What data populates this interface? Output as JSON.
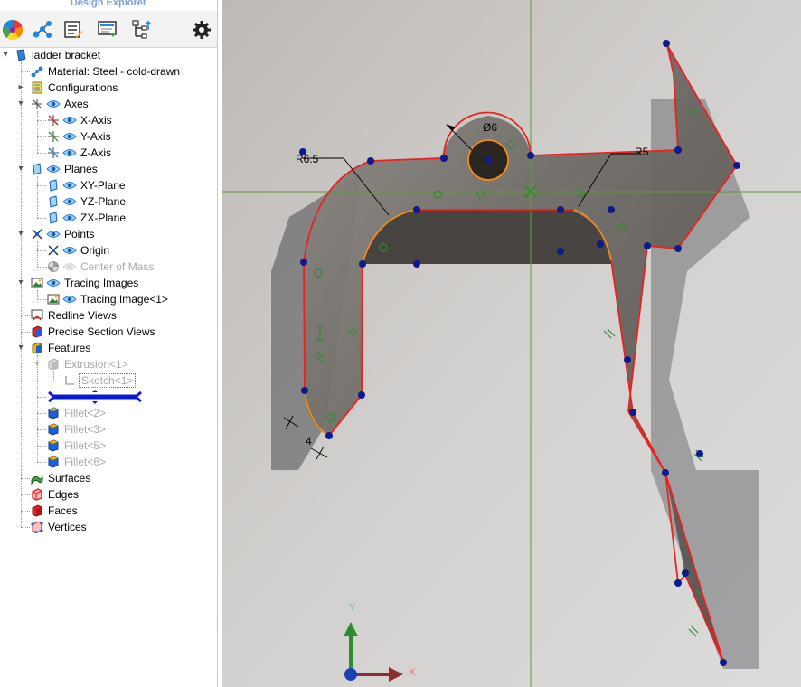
{
  "explorer": {
    "title": "Design Explorer",
    "toolbar": {
      "appearance": "color-wheel-icon",
      "relations": "relations-icon",
      "properties": "properties-icon",
      "view": "view-icon",
      "tree_mode": "tree-mode-icon",
      "settings": "gear-icon"
    },
    "tree": {
      "root": "ladder bracket",
      "material": "Material: Steel - cold-drawn",
      "configurations": "Configurations",
      "axes": "Axes",
      "x_axis": "X-Axis",
      "y_axis": "Y-Axis",
      "z_axis": "Z-Axis",
      "planes": "Planes",
      "xy_plane": "XY-Plane",
      "yz_plane": "YZ-Plane",
      "zx_plane": "ZX-Plane",
      "points": "Points",
      "origin": "Origin",
      "center_of_mass": "Center of Mass",
      "tracing_images": "Tracing Images",
      "tracing_image_1": "Tracing Image<1>",
      "redline_views": "Redline Views",
      "precise_section_views": "Precise Section Views",
      "features": "Features",
      "extrusion_1": "Extrusion<1>",
      "sketch_1": "Sketch<1>",
      "fillet_2": "Fillet<2>",
      "fillet_3": "Fillet<3>",
      "fillet_5": "Fillet<5>",
      "fillet_6": "Fillet<6>",
      "surfaces": "Surfaces",
      "edges": "Edges",
      "faces": "Faces",
      "vertices": "Vertices"
    }
  },
  "viewport": {
    "dimensions": {
      "hole_diameter": "Ø6",
      "radius_outer_left": "R6.5",
      "radius_outer_right": "R5",
      "thickness": "4"
    },
    "triad": {
      "x_label": "X",
      "y_label": "Y"
    },
    "colors": {
      "sketch_line": "#e8231f",
      "sketch_arc": "#f08a1c",
      "sketch_point": "#0b1a8c",
      "origin_axes": "#5c9e2f",
      "constraint": "#2f8c2f"
    }
  }
}
